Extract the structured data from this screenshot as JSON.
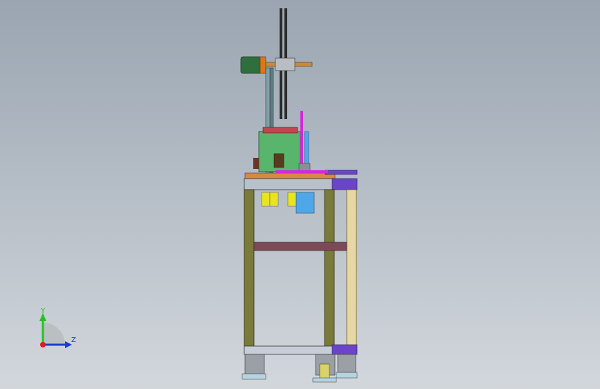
{
  "viewport": {
    "background_top": "#9aa5b1",
    "background_bottom": "#d2d7dc"
  },
  "triad": {
    "y_label": "Y",
    "z_label": "Z",
    "y_color": "#22c322",
    "z_color": "#1e3ad6",
    "x_color": "#e01b1b"
  },
  "model": {
    "frame_olive": "#7a7a3a",
    "frame_light": "#e6d7a3",
    "frame_purple": "#6a45c8",
    "motor_green": "#2f6e3d",
    "motor_orange": "#d9771a",
    "box_green": "#59b56b",
    "plate_orange": "#d88a3c",
    "cylinder_yellow": "#e8e520",
    "cylinder_blue": "#4fa7e8",
    "accent_magenta": "#d12ad9",
    "crossbar_maroon": "#7b4a56",
    "caster_gray": "#9aa0a6"
  }
}
